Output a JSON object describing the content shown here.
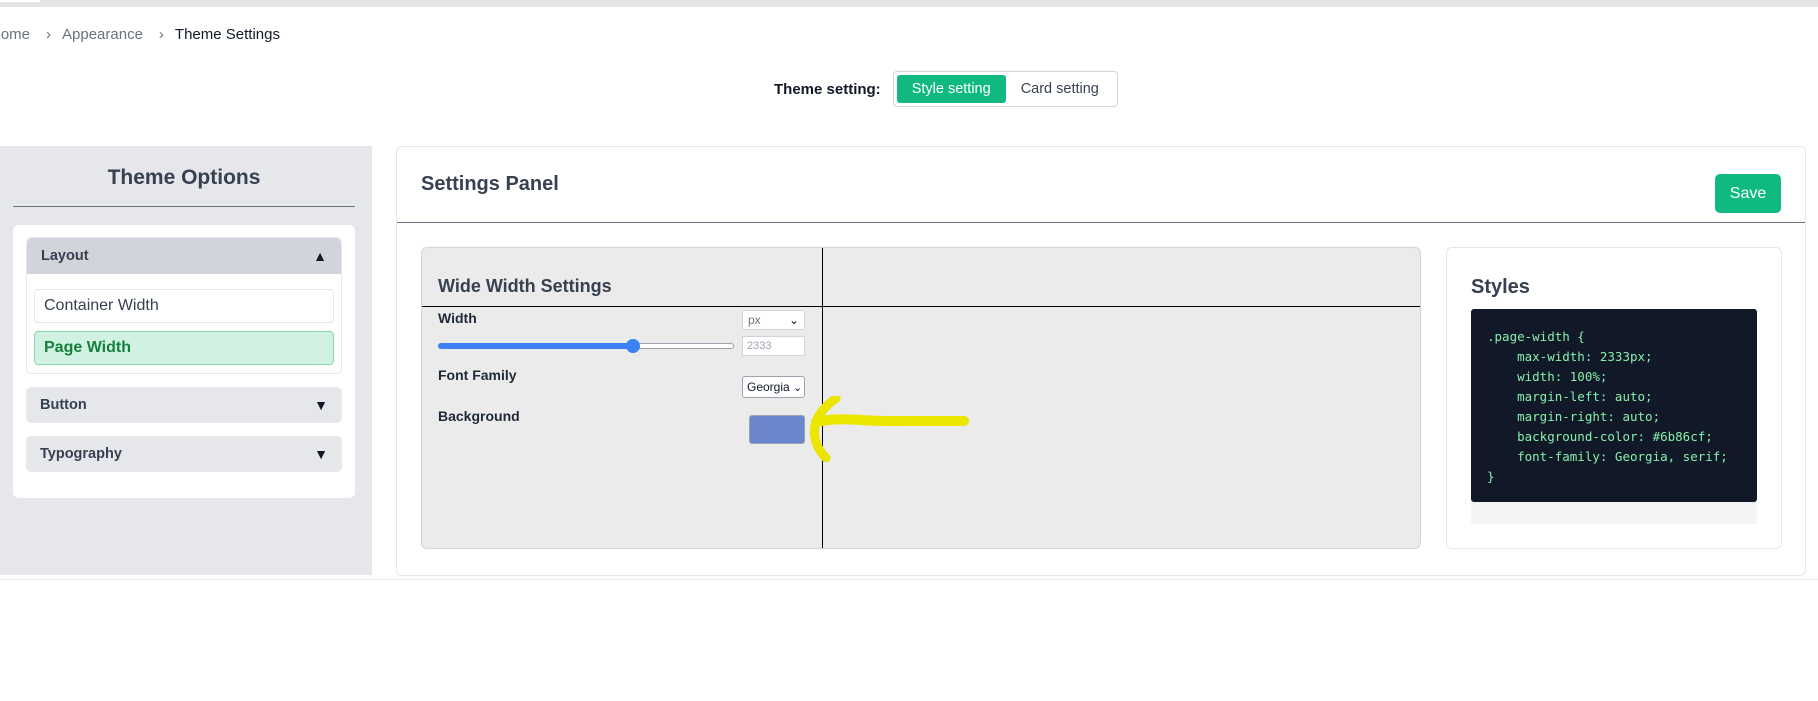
{
  "breadcrumb": {
    "home": "Home",
    "appearance": "Appearance",
    "current": "Theme Settings",
    "separator": "›"
  },
  "theme_setting": {
    "label": "Theme setting:",
    "options": [
      "Style setting",
      "Card setting"
    ],
    "active": "Style setting"
  },
  "sidebar": {
    "title": "Theme Options",
    "sections": [
      {
        "label": "Layout",
        "arrow": "▲",
        "items": [
          "Container Width",
          "Page Width"
        ],
        "active_item": "Page Width"
      },
      {
        "label": "Button",
        "arrow": "▼"
      },
      {
        "label": "Typography",
        "arrow": "▼"
      }
    ]
  },
  "settings_panel": {
    "title": "Settings Panel",
    "save_label": "Save",
    "preview": {
      "title": "Wide Width Settings",
      "width_label": "Width",
      "unit": "px",
      "unit_chevron": "⌄",
      "width_value": "2333",
      "slider_fraction": 0.66,
      "font_family_label": "Font Family",
      "font_family_value": "Georgia",
      "font_chevron": "⌄",
      "background_label": "Background",
      "background_color": "#6b86cf"
    }
  },
  "styles": {
    "title": "Styles",
    "code": ".page-width {\n    max-width: 2333px;\n    width: 100%;\n    margin-left: auto;\n    margin-right: auto;\n    background-color: #6b86cf;\n    font-family: Georgia, serif;\n}"
  },
  "colors": {
    "accent": "#10b981",
    "slider": "#3b82f6",
    "code_bg": "#111827",
    "code_text": "#86efac",
    "highlight_arrow": "#ebe500"
  }
}
